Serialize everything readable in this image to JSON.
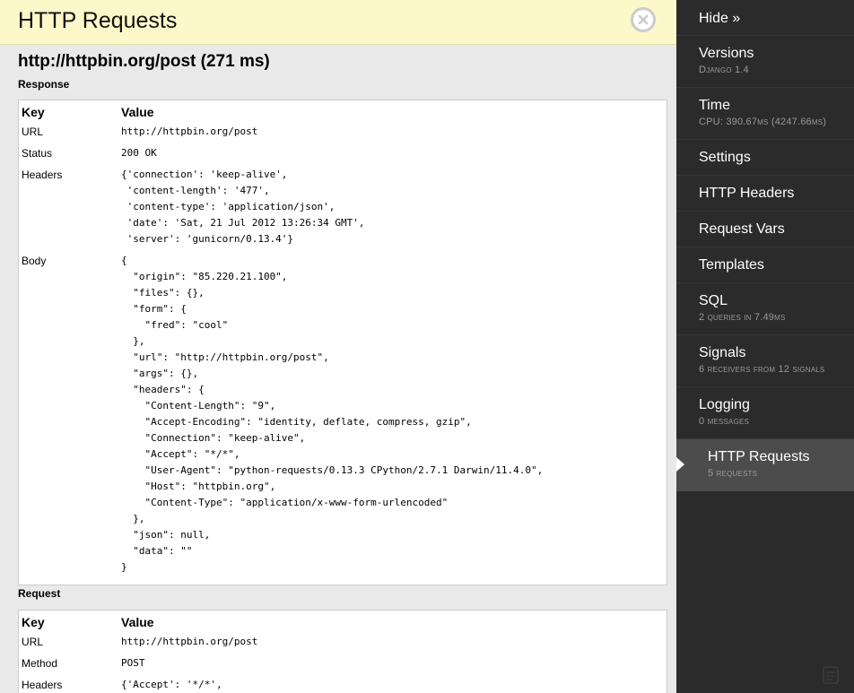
{
  "panel": {
    "title": "HTTP Requests",
    "request_heading": "http://httpbin.org/post (271 ms)"
  },
  "response": {
    "label": "Response",
    "header_key": "Key",
    "header_value": "Value",
    "rows": [
      {
        "key": "URL",
        "value": "http://httpbin.org/post"
      },
      {
        "key": "Status",
        "value": "200 OK"
      },
      {
        "key": "Headers",
        "value": "{'connection': 'keep-alive',\n 'content-length': '477',\n 'content-type': 'application/json',\n 'date': 'Sat, 21 Jul 2012 13:26:34 GMT',\n 'server': 'gunicorn/0.13.4'}"
      },
      {
        "key": "Body",
        "value": "{\n  \"origin\": \"85.220.21.100\",\n  \"files\": {},\n  \"form\": {\n    \"fred\": \"cool\"\n  },\n  \"url\": \"http://httpbin.org/post\",\n  \"args\": {},\n  \"headers\": {\n    \"Content-Length\": \"9\",\n    \"Accept-Encoding\": \"identity, deflate, compress, gzip\",\n    \"Connection\": \"keep-alive\",\n    \"Accept\": \"*/*\",\n    \"User-Agent\": \"python-requests/0.13.3 CPython/2.7.1 Darwin/11.4.0\",\n    \"Host\": \"httpbin.org\",\n    \"Content-Type\": \"application/x-www-form-urlencoded\"\n  },\n  \"json\": null,\n  \"data\": \"\"\n}"
      }
    ]
  },
  "request": {
    "label": "Request",
    "header_key": "Key",
    "header_value": "Value",
    "rows": [
      {
        "key": "URL",
        "value": "http://httpbin.org/post"
      },
      {
        "key": "Method",
        "value": "POST"
      },
      {
        "key": "Headers",
        "value": "{'Accept': '*/*',\n 'Accept-Encoding': 'identity, deflate, compress, gzip',"
      }
    ]
  },
  "sidebar": {
    "hide_label": "Hide »",
    "items": [
      {
        "title": "Versions",
        "subtitle": "Django 1.4"
      },
      {
        "title": "Time",
        "subtitle": "CPU: 390.67ms (4247.66ms)"
      },
      {
        "title": "Settings",
        "subtitle": ""
      },
      {
        "title": "HTTP Headers",
        "subtitle": ""
      },
      {
        "title": "Request Vars",
        "subtitle": ""
      },
      {
        "title": "Templates",
        "subtitle": ""
      },
      {
        "title": "SQL",
        "subtitle": "2 queries in 7.49ms"
      },
      {
        "title": "Signals",
        "subtitle": "6 receivers from 12 signals"
      },
      {
        "title": "Logging",
        "subtitle": "0 messages"
      },
      {
        "title": "HTTP Requests",
        "subtitle": "5 requests"
      }
    ],
    "active_index": 9
  },
  "icons": {
    "close": "close-circle-icon",
    "active_arrow": "triangle-right-icon",
    "corner": "corner-mark-icon"
  },
  "colors": {
    "header_bg": "#fcf8c9",
    "sidebar_bg": "#2b2b2b",
    "sidebar_active_bg": "#4c4c4c",
    "content_bg": "#e9e9e9"
  }
}
